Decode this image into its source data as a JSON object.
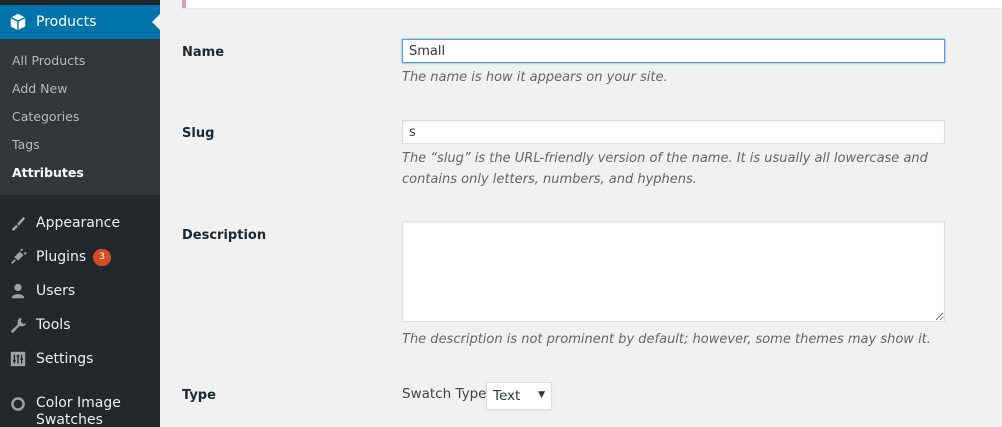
{
  "sidebar": {
    "current": {
      "label": "Products",
      "icon": "products-icon"
    },
    "submenu": [
      {
        "label": "All Products"
      },
      {
        "label": "Add New"
      },
      {
        "label": "Categories"
      },
      {
        "label": "Tags"
      },
      {
        "label": "Attributes",
        "current": true
      }
    ],
    "menu": [
      {
        "label": "Appearance",
        "icon": "appearance-icon"
      },
      {
        "label": "Plugins",
        "icon": "plugins-icon",
        "badge": "3"
      },
      {
        "label": "Users",
        "icon": "users-icon"
      },
      {
        "label": "Tools",
        "icon": "tools-icon"
      },
      {
        "label": "Settings",
        "icon": "settings-icon"
      },
      {
        "label": "Color Image Swatches",
        "icon": "color-swatches-icon"
      }
    ]
  },
  "form": {
    "name": {
      "label": "Name",
      "value": "Small",
      "description": "The name is how it appears on your site."
    },
    "slug": {
      "label": "Slug",
      "value": "s",
      "description": "The “slug” is the URL-friendly version of the name. It is usually all lowercase and contains only letters, numbers, and hyphens."
    },
    "description": {
      "label": "Description",
      "value": "",
      "description": "The description is not prominent by default; however, some themes may show it."
    },
    "type": {
      "label": "Type",
      "swatch_label": "Swatch Type",
      "selected": "Text"
    }
  },
  "colors": {
    "sidebar_bg": "#23282d",
    "submenu_bg": "#32373c",
    "accent": "#0073aa",
    "badge": "#d54e21"
  }
}
